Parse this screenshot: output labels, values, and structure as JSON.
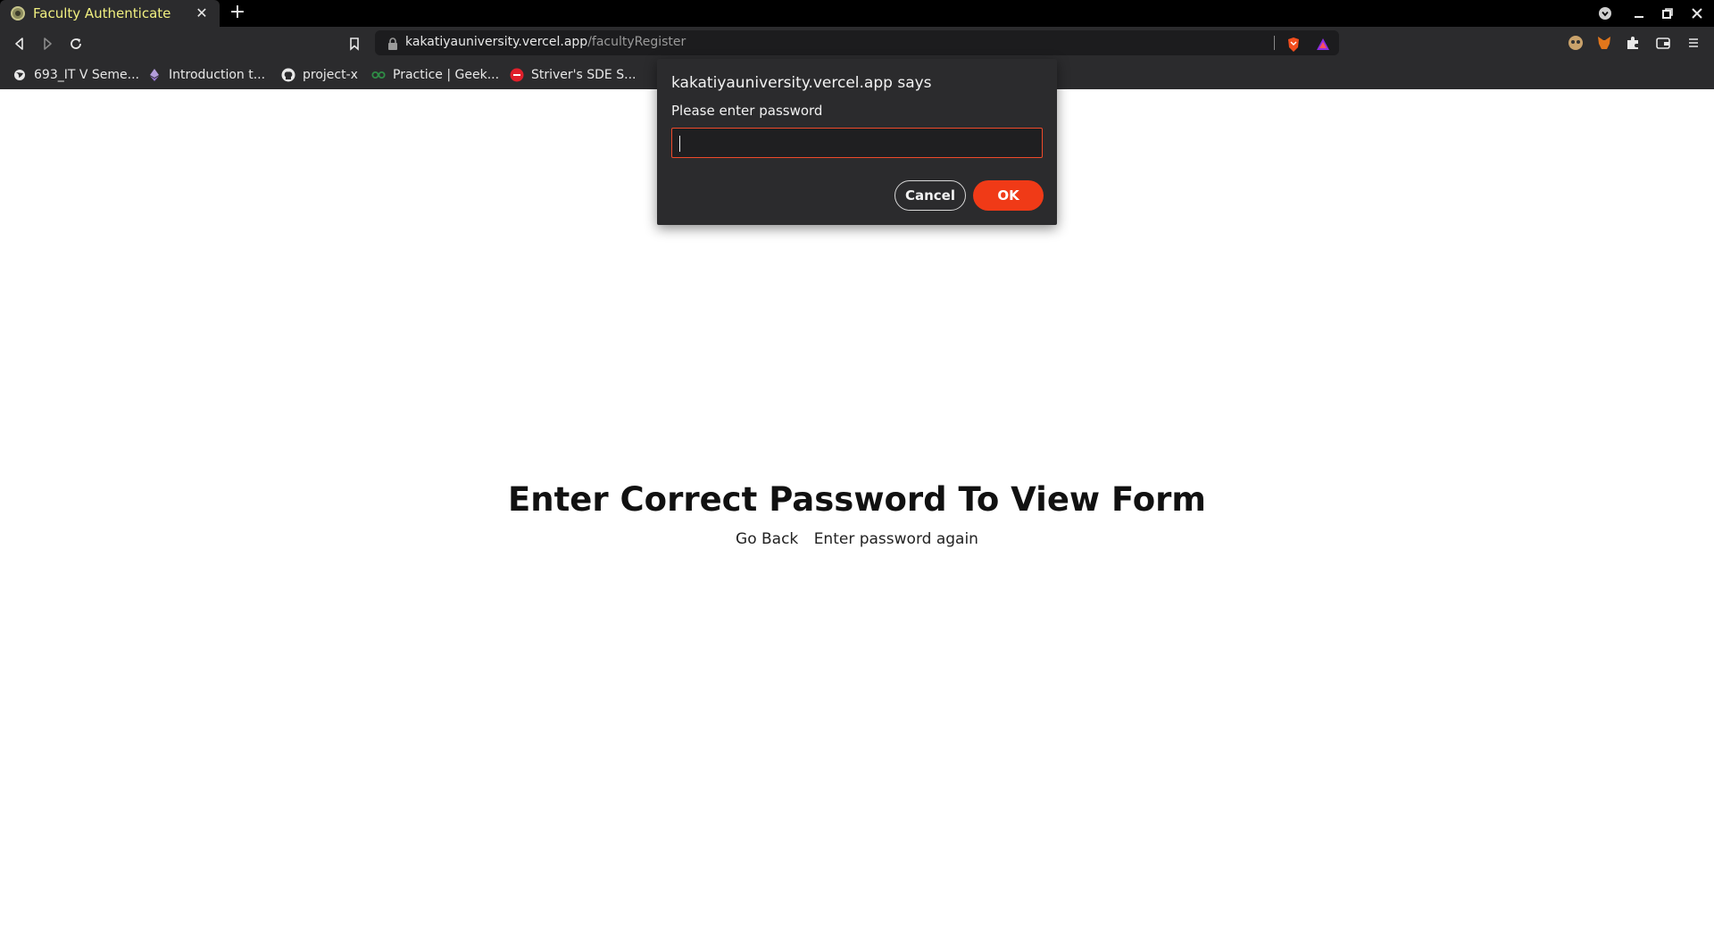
{
  "browser": {
    "tab": {
      "title": "Faculty Authenticate",
      "close_glyph": "✕"
    },
    "new_tab_glyph": "+",
    "url": {
      "host": "kakatiyauniversity.vercel.app",
      "path": "/facultyRegister"
    },
    "bookmarks": [
      {
        "label": "693_IT V Seme...",
        "icon": "globe-icon"
      },
      {
        "label": "Introduction t...",
        "icon": "ethereum-icon"
      },
      {
        "label": "project-x",
        "icon": "github-icon"
      },
      {
        "label": "Practice | Geek...",
        "icon": "geeksforgeeks-icon"
      },
      {
        "label": "Striver's SDE S...",
        "icon": "tuf-icon"
      }
    ]
  },
  "page": {
    "heading": "Enter Correct Password To View Form",
    "links": {
      "go_back": "Go Back",
      "retry": "Enter password again"
    }
  },
  "dialog": {
    "title": "kakatiyauniversity.vercel.app says",
    "message": "Please enter password",
    "input_value": "",
    "cancel_label": "Cancel",
    "ok_label": "OK"
  },
  "colors": {
    "accent": "#f03a17",
    "chrome_bg": "#2b2b2d",
    "tab_title": "#f1f080"
  }
}
